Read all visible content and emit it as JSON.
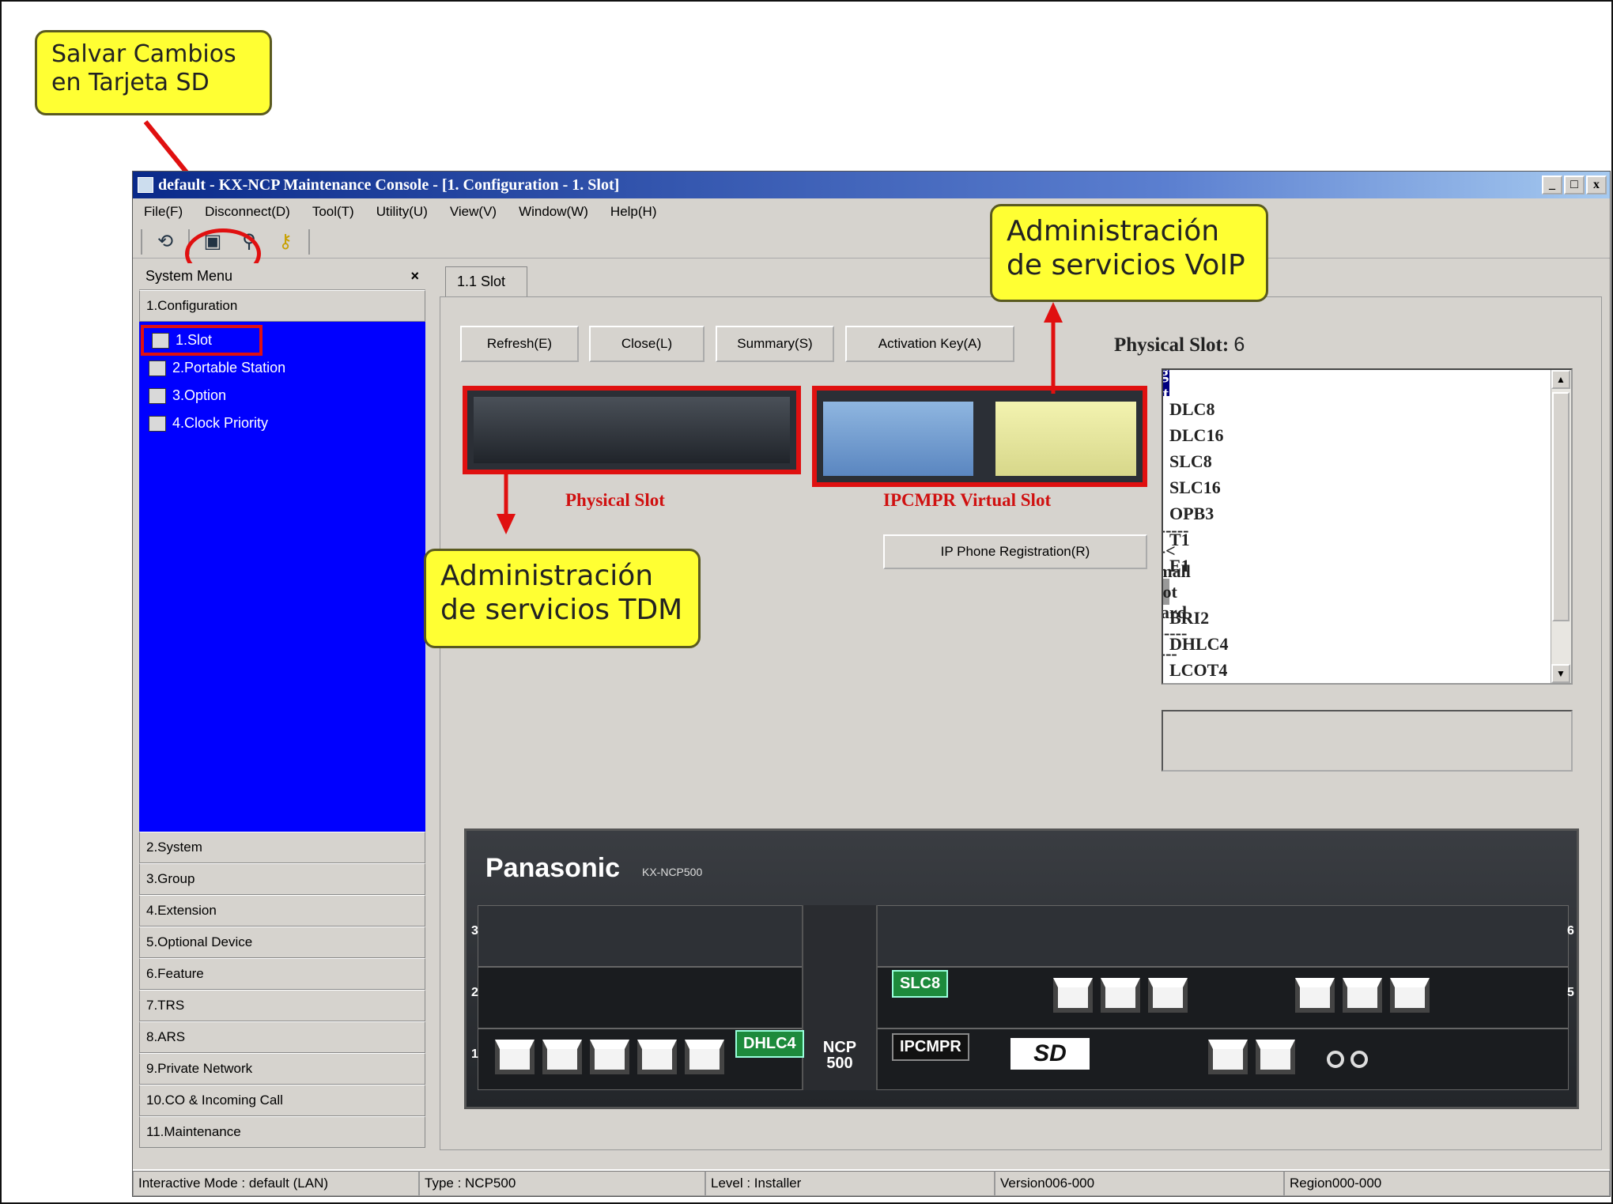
{
  "callouts": {
    "save_sd": "Salvar Cambios en Tarjeta SD",
    "voip": "Administración de servicios VoIP",
    "tdm": "Administración de servicios TDM"
  },
  "window": {
    "title": "default - KX-NCP Maintenance Console - [1. Configuration - 1. Slot]",
    "controls": [
      "_",
      "□",
      "x"
    ]
  },
  "menu": [
    "File(F)",
    "Disconnect(D)",
    "Tool(T)",
    "Utility(U)",
    "View(V)",
    "Window(W)",
    "Help(H)"
  ],
  "toolbar_icons": [
    "connect-icon",
    "save-sd-icon",
    "user-search-icon",
    "keys-icon"
  ],
  "sidebar": {
    "header": "System Menu",
    "close": "×",
    "top_section": "1.Configuration",
    "tree": [
      {
        "label": "1.Slot",
        "icon": "slot-icon"
      },
      {
        "label": "2.Portable Station",
        "icon": "portable-station-icon"
      },
      {
        "label": "3.Option",
        "icon": "option-icon"
      },
      {
        "label": "4.Clock Priority",
        "icon": "clock-priority-icon"
      }
    ],
    "sections": [
      "2.System",
      "3.Group",
      "4.Extension",
      "5.Optional Device",
      "6.Feature",
      "7.TRS",
      "8.ARS",
      "9.Private Network",
      "10.CO & Incoming Call",
      "11.Maintenance"
    ]
  },
  "tab": "1.1 Slot",
  "buttons": {
    "refresh": "Refresh(E)",
    "close": "Close(L)",
    "summary": "Summary(S)",
    "activation": "Activation Key(A)",
    "ip_phone": "IP Phone Registration(R)"
  },
  "physical_slot": {
    "label": "Physical Slot:",
    "value": "6"
  },
  "slot_labels": {
    "physical": "Physical Slot",
    "virtual": "IPCMPR Virtual Slot"
  },
  "card_list": [
    {
      "label": "----------< Regular Slot Card >----------",
      "selected": true,
      "separator": true
    },
    {
      "label": "DLC8"
    },
    {
      "label": "DLC16"
    },
    {
      "label": "SLC8"
    },
    {
      "label": "SLC16"
    },
    {
      "label": "OPB3"
    },
    {
      "label": "T1"
    },
    {
      "label": "E1"
    },
    {
      "label": "----------< Small Slot Card >----------",
      "separator": true
    },
    {
      "label": "BRI2"
    },
    {
      "label": "DHLC4"
    },
    {
      "label": "LCOT4"
    }
  ],
  "device": {
    "brand": "Panasonic",
    "model": "KX-NCP500",
    "center_label": "NCP 500",
    "cards": [
      "SLC8",
      "IPCMPR",
      "DHLC4"
    ],
    "slot_numbers": [
      "3",
      "2",
      "1",
      "6",
      "5"
    ],
    "sd_label": "SD"
  },
  "status": [
    "Interactive Mode : default (LAN)",
    "Type : NCP500",
    "Level : Installer",
    "Version006-000",
    "Region000-000"
  ],
  "colors": {
    "accent_red": "#e01010",
    "tree_blue": "#0000ff",
    "callout_yellow": "#ffff33",
    "selected_navy": "#000080"
  }
}
